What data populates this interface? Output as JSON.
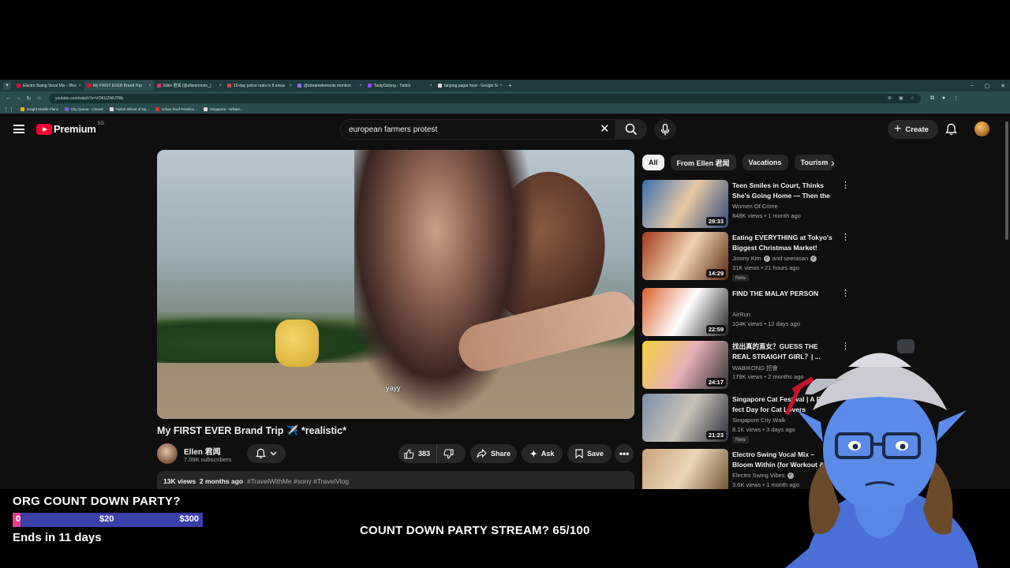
{
  "browser": {
    "tabs": [
      {
        "label": "Electro Swing Vocal Mix – Bloo",
        "color": "#ff0033",
        "active": false
      },
      {
        "label": "My FIRST EVER Brand Trip",
        "color": "#ff0033",
        "active": true
      },
      {
        "label": "Ellen 君闻 (@elleninnnnn_)",
        "color": "#e1306c",
        "active": false
      },
      {
        "label": "10-day police raids in 8 areas",
        "color": "#d04a3a",
        "active": false
      },
      {
        "label": "@streamelements mention",
        "color": "#8d6cf0",
        "active": false
      },
      {
        "label": "TastyOolong - Twitch",
        "color": "#9146ff",
        "active": false
      },
      {
        "label": "tanjong pagar food - Google Se",
        "color": "#dddddd",
        "active": false
      }
    ],
    "new_tab": "+",
    "window_controls": [
      "–",
      "▢",
      "✕"
    ],
    "url": "youtube.com/watch?v=VOKUZWUTMc",
    "bookmarks": [
      {
        "label": "insight Mobile Plans",
        "color": "#f4b400"
      },
      {
        "label": "Clip Queue - Closed",
        "color": "#6e5ed6"
      },
      {
        "label": "Twitch Wheel of Na...",
        "color": "#dddddd"
      },
      {
        "label": "Urban Roof Penthou...",
        "color": "#d33"
      },
      {
        "label": "Singapore - Wikipe...",
        "color": "#dddddd"
      }
    ]
  },
  "youtube": {
    "logo_text": "Premium",
    "region": "SG",
    "search_query": "european farmers protest",
    "create_label": "Create",
    "video": {
      "caption": "yayy",
      "title": "My FIRST EVER Brand Trip ✈️ *realistic*",
      "channel": "Ellen 君闻",
      "subscribers": "7.09K subscribers",
      "likes": "383",
      "share_label": "Share",
      "ask_label": "Ask",
      "save_label": "Save",
      "views": "13K views",
      "age": "2 months ago",
      "tags": "#TravelWithMe #sony #TravelVlog"
    },
    "chips": [
      "All",
      "From Ellen 君闻",
      "Vacations",
      "Tourism"
    ],
    "recommendations": [
      {
        "title": "Teen Smiles in Court, Thinks She's Going Home — Then the ...",
        "channel": "Women Of Crime",
        "verified": false,
        "views": "848K views",
        "age": "1 month ago",
        "duration": "29:33",
        "new": false,
        "colors": [
          "#3a6fb0",
          "#e8c9a5",
          "#2e4a7a"
        ]
      },
      {
        "title": "Eating EVERYTHING at Tokyo's Biggest Christmas Market!",
        "channel": "Jimmy Kim",
        "verified": true,
        "channel_extra": "and seerasan",
        "views": "31K views",
        "age": "21 hours ago",
        "duration": "14:29",
        "new": true,
        "new_label": "New",
        "colors": [
          "#a23a1a",
          "#f0d2b0",
          "#5b2a12"
        ]
      },
      {
        "title": "FIND THE MALAY PERSON",
        "channel": "AirRun",
        "verified": false,
        "views": "104K views",
        "age": "12 days ago",
        "duration": "22:59",
        "new": false,
        "colors": [
          "#d9602a",
          "#ffffff",
          "#222222"
        ]
      },
      {
        "title": "找出真的直女？GUESS THE REAL STRAIGHT GIRL？| ...",
        "channel": "WABIKONG 挖會",
        "verified": false,
        "views": "179K views",
        "age": "2 months ago",
        "duration": "24:17",
        "new": false,
        "colors": [
          "#f2d23a",
          "#e8b0b8",
          "#333333"
        ]
      },
      {
        "title": "Singapore Cat Festival | A Purr-fect Day for Cat Lovers",
        "channel": "Singapore City Walk",
        "verified": false,
        "views": "8.1K views",
        "age": "3 days ago",
        "duration": "21:23",
        "new": true,
        "new_label": "New",
        "colors": [
          "#7b8fa8",
          "#c9c2b8",
          "#2b2f3a"
        ]
      },
      {
        "title": "Electro Swing Vocal Mix – Bloom Within (for Workout & ...",
        "channel": "Electro Swing Vibes",
        "verified": true,
        "views": "3.6K views",
        "age": "1 month ago",
        "duration": "",
        "new": false,
        "colors": [
          "#c9a47a",
          "#e9d6b8",
          "#6b4a2a"
        ]
      }
    ]
  },
  "overlay": {
    "goal_title": "ORG COUNT DOWN PARTY?",
    "goal_progress": 0.04,
    "goal_start": "0",
    "goal_mid": "$20",
    "goal_end": "$300",
    "goal_ends": "Ends in 11 days",
    "stream_message": "COUNT DOWN PARTY STREAM? 65/100",
    "colors": {
      "bar": "#3b3fa8",
      "fill": "#e83e8c"
    }
  }
}
